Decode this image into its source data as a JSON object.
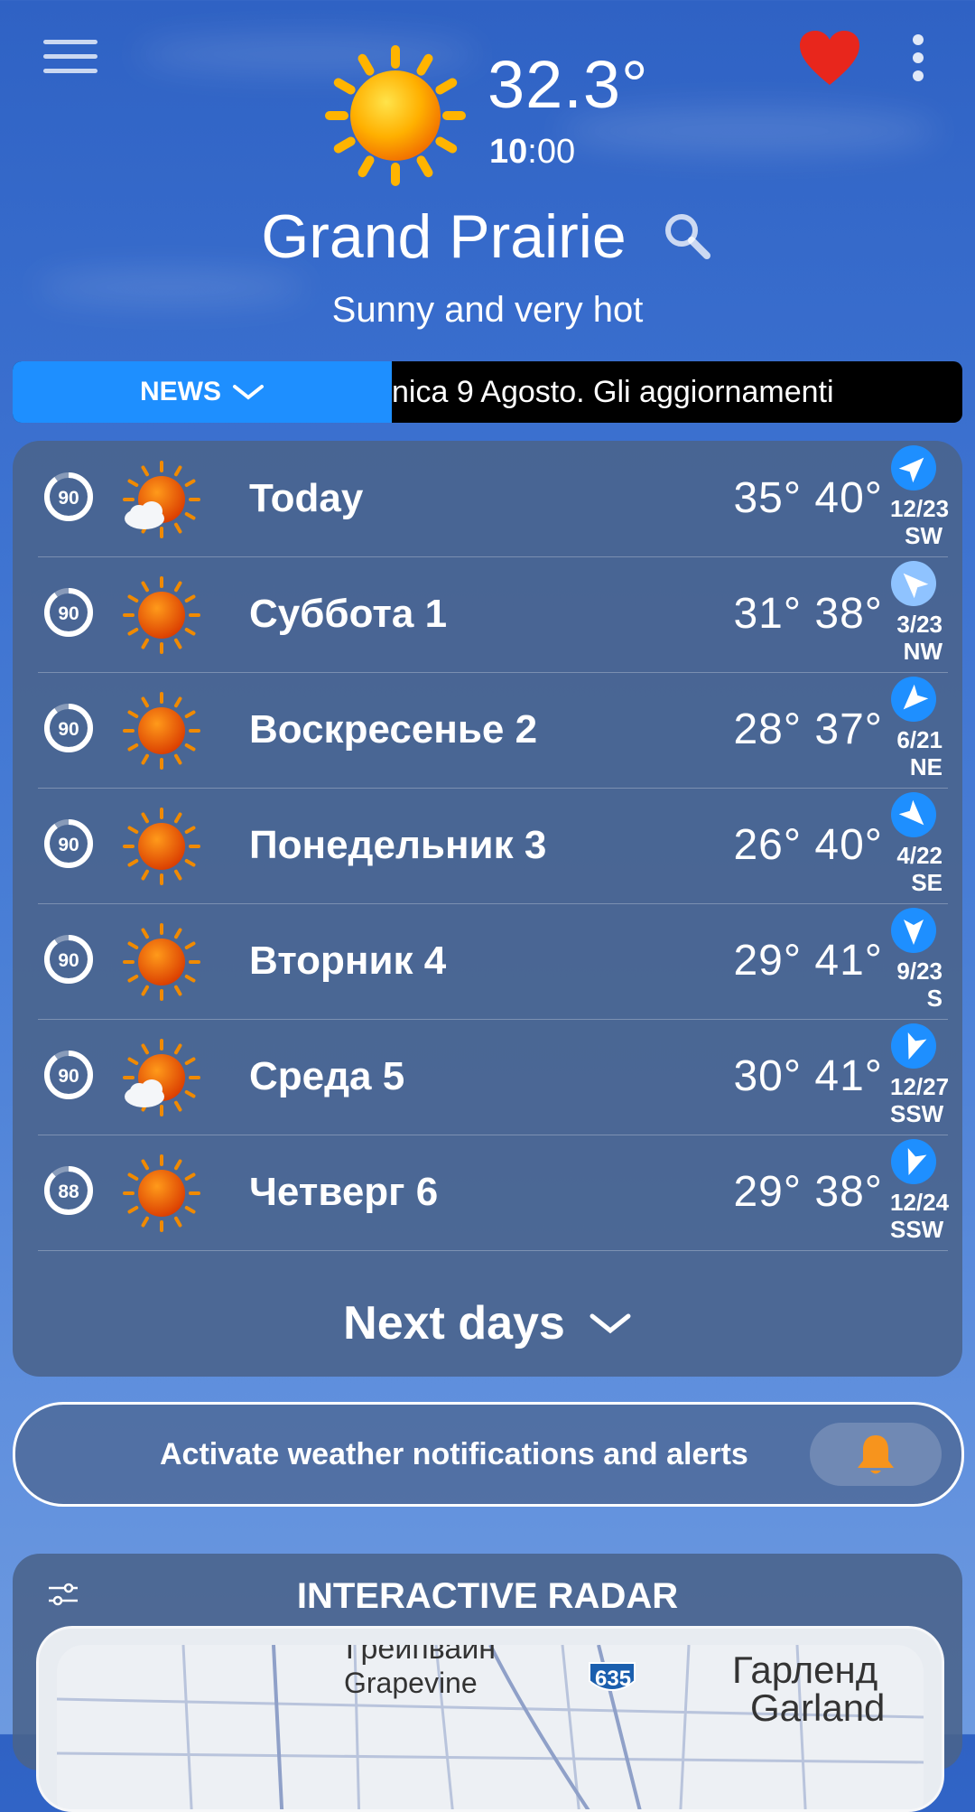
{
  "header": {
    "temperature": "32.3°",
    "time_hour": "10",
    "time_rest": ":00",
    "city": "Grand Prairie",
    "description": "Sunny and very hot"
  },
  "news": {
    "button_label": "NEWS",
    "ticker_text": "nica 9 Agosto. Gli aggiornamenti"
  },
  "forecast": [
    {
      "percent": "90",
      "icon": "sun-cloud-icon",
      "day": "Today",
      "temps": "35° 40°",
      "wind_speed": "12/23",
      "wind_dir": "SW"
    },
    {
      "percent": "90",
      "icon": "sun-icon",
      "day": "Суббота 1",
      "temps": "31° 38°",
      "wind_speed": "3/23",
      "wind_dir": "NW"
    },
    {
      "percent": "90",
      "icon": "sun-icon",
      "day": "Воскресенье 2",
      "temps": "28° 37°",
      "wind_speed": "6/21",
      "wind_dir": "NE"
    },
    {
      "percent": "90",
      "icon": "sun-icon",
      "day": "Понедельник 3",
      "temps": "26° 40°",
      "wind_speed": "4/22",
      "wind_dir": "SE"
    },
    {
      "percent": "90",
      "icon": "sun-icon",
      "day": "Вторник 4",
      "temps": "29° 41°",
      "wind_speed": "9/23",
      "wind_dir": "S"
    },
    {
      "percent": "90",
      "icon": "sun-cloud-icon",
      "day": "Среда 5",
      "temps": "30° 41°",
      "wind_speed": "12/27",
      "wind_dir": "SSW"
    },
    {
      "percent": "88",
      "icon": "sun-icon",
      "day": "Четверг 6",
      "temps": "29° 38°",
      "wind_speed": "12/24",
      "wind_dir": "SSW"
    }
  ],
  "next_days_label": "Next days",
  "notifications": {
    "label": "Activate weather notifications and alerts"
  },
  "radar": {
    "title": "INTERACTIVE RADAR",
    "map_labels": {
      "grapevine_ru": "Грейпвайн",
      "grapevine": "Grapevine",
      "highway": "635",
      "garland_ru": "Гарленд",
      "garland": "Garland"
    }
  },
  "colors": {
    "accent_blue": "#1e8fff",
    "heart_red": "#e8261c",
    "bell_orange": "#f7941d",
    "card_bg": "#4a638b"
  }
}
